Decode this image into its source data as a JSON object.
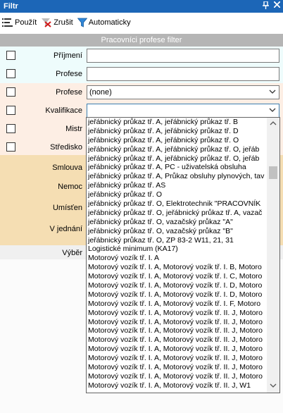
{
  "window": {
    "title": "Filtr"
  },
  "toolbar": {
    "apply_label": "Použít",
    "cancel_label": "Zrušit",
    "auto_label": "Automaticky"
  },
  "section": {
    "title": "Pracovníci profese filter"
  },
  "form": {
    "prijmeni": {
      "label": "Příjmení",
      "value": ""
    },
    "profese_text": {
      "label": "Profese",
      "value": ""
    },
    "profese_combo": {
      "label": "Profese",
      "value": "(none)"
    },
    "kvalifikace": {
      "label": "Kvalifikace",
      "value": ""
    },
    "mistr": {
      "label": "Mistr"
    },
    "stredisko": {
      "label": "Středisko"
    },
    "smlouva": {
      "label": "Smlouva"
    },
    "nemoc": {
      "label": "Nemoc"
    },
    "umisten": {
      "label": "Umísťen"
    },
    "vjednani": {
      "label": "V jednání"
    },
    "vyber": {
      "label": "Výběr"
    }
  },
  "dropdown": {
    "items": [
      "jeřábnický průkaz tř. A, jeřábnický průkaz tř. B",
      "jeřábnický průkaz tř. A, jeřábnický průkaz tř. D",
      "jeřábnický průkaz tř. A, jeřábnický průkaz tř. O",
      "jeřábnický průkaz tř. A, jeřábnický průkaz tř. O, jeřáb",
      "jeřábnický průkaz tř. A, jeřábnický průkaz tř. O, jeřáb",
      "jeřábnický průkaz tř. A, PC - uživatelská obsluha",
      "jeřábnický průkaz tř. A, Průkaz obsluhy plynových, tav",
      "jeřábnický průkaz tř. AS",
      "jeřábnický průkaz tř. O",
      "jeřábnický průkaz tř. O, Elektrotechnik \"PRACOVNÍK",
      "jeřábnický průkaz tř. O, jeřábnický průkaz tř. A, vazač",
      "jeřábnický průkaz tř. O, vazačský průkaz \"A\"",
      "jeřábnický průkaz tř. O, vazačský průkaz \"B\"",
      "jeřábnický průkaz tř. O, ZP 83-2 W11, 21, 31",
      "Logistické minimum (KA17)",
      "Motorový vozík tř. I. A",
      "Motorový vozík tř. I. A, Motorový vozík tř. I. B, Motoro",
      "Motorový vozík tř. I. A, Motorový vozík tř. I. C, Motoro",
      "Motorový vozík tř. I. A, Motorový vozík tř. I. D, Motoro",
      "Motorový vozík tř. I. A, Motorový vozík tř. I. D, Motoro",
      "Motorový vozík tř. I. A, Motorový vozík tř. I. F, Motoro",
      "Motorový vozík tř. I. A, Motorový vozík tř. II. J, Motoro",
      "Motorový vozík tř. I. A, Motorový vozík tř. II. J, Motoro",
      "Motorový vozík tř. I. A, Motorový vozík tř. II. J, Motoro",
      "Motorový vozík tř. I. A, Motorový vozík tř. II. J, Motoro",
      "Motorový vozík tř. I. A, Motorový vozík tř. II. J, Motoro",
      "Motorový vozík tř. I. A, Motorový vozík tř. II. J, Motoro",
      "Motorový vozík tř. I. A, Motorový vozík tř. II. J, Motoro",
      "Motorový vozík tř. I. A, Motorový vozík tř. II. J, Motoro",
      "Motorový vozík tř. I. A, Motorový vozík tř. II. J, W1"
    ]
  },
  "colors": {
    "title_bar": "#1c66b7",
    "section_header": "#b5b5b5",
    "text_row_bg": "#eefcfc",
    "combo_row_bg": "#fdeee4",
    "tan_row_bg": "#f5deb3",
    "grey_row_bg": "#f0f0f0",
    "focus_border": "#3c7fb1"
  },
  "icons": {
    "pin": "pin-icon",
    "close": "close-icon",
    "apply": "apply-filter-icon",
    "cancel": "cancel-filter-icon",
    "auto": "funnel-icon"
  }
}
